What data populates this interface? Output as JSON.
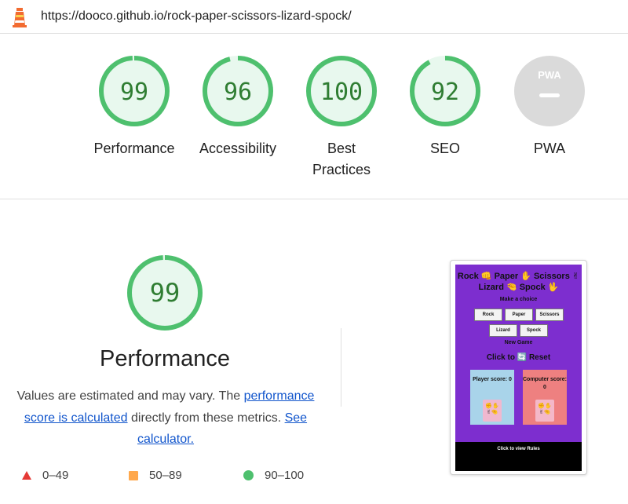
{
  "header": {
    "url": "https://dooco.github.io/rock-paper-scissors-lizard-spock/",
    "logo_icon": "lighthouse-icon"
  },
  "gauges": [
    {
      "id": "performance",
      "score": "99",
      "label": "Performance",
      "fraction": 0.99,
      "color": "#0cce6b"
    },
    {
      "id": "accessibility",
      "score": "96",
      "label": "Accessibility",
      "fraction": 0.96,
      "color": "#0cce6b"
    },
    {
      "id": "best-practices",
      "score": "100",
      "label": "Best Practices",
      "fraction": 1.0,
      "color": "#0cce6b"
    },
    {
      "id": "seo",
      "score": "92",
      "label": "SEO",
      "fraction": 0.92,
      "color": "#0cce6b"
    },
    {
      "id": "pwa",
      "score": "PWA",
      "label": "PWA",
      "fraction": 0,
      "color": "#9e9e9e"
    }
  ],
  "performance": {
    "score": "99",
    "fraction": 0.99,
    "title": "Performance",
    "desc_prefix": "Values are estimated and may vary. The ",
    "desc_link1": "performance score is calculated",
    "desc_middle": " directly from these metrics. ",
    "desc_link2": "See calculator."
  },
  "legend": [
    {
      "shape": "triangle",
      "range": "0–49",
      "color": "#e53935"
    },
    {
      "shape": "square",
      "range": "50–89",
      "color": "#ffa84c"
    },
    {
      "shape": "circle",
      "range": "90–100",
      "color": "#4ec06e"
    }
  ],
  "thumbnail": {
    "title": "Rock 👊 Paper ✋ Scissors ✌ Lizard 🤏 Spock 🖖",
    "subtitle": "Make a choice",
    "buttons": [
      "Rock",
      "Paper",
      "Scissors",
      "Lizard",
      "Spock"
    ],
    "new_game": "New Game",
    "reset": "Click to 🔄 Reset",
    "player_label": "Player score: 0",
    "computer_label": "Computer score: 0",
    "footer": "Click to view Rules"
  }
}
